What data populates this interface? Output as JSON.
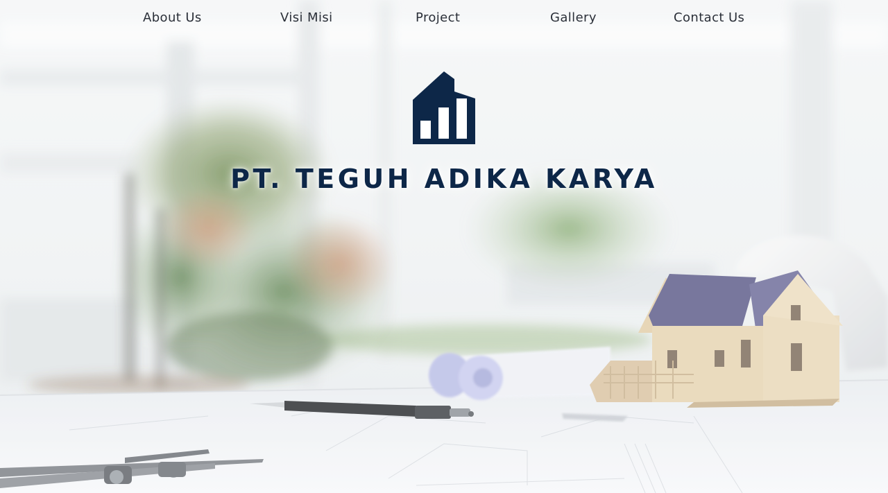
{
  "nav": {
    "items": [
      {
        "label": "About Us"
      },
      {
        "label": "Visi Misi"
      },
      {
        "label": "Project"
      },
      {
        "label": "Gallery"
      },
      {
        "label": "Contact Us"
      }
    ]
  },
  "brand": {
    "name": "PT. TEGUH ADIKA KARYA",
    "logo_icon": "building-chart-icon",
    "color": "#0d2748"
  },
  "hero": {
    "background": "architect-desk-photo"
  }
}
